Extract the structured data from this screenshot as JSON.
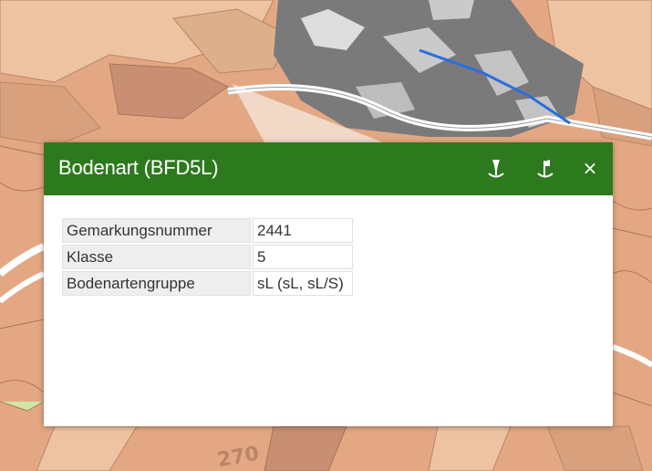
{
  "map": {
    "contour_label": "270",
    "colors": {
      "soil_base": "#e3a883",
      "soil_light": "#edc3a1",
      "soil_dark": "#c98f72",
      "settlement": "#7a7a7a",
      "water_line": "#2a6de0",
      "road": "#ffffff"
    }
  },
  "popup": {
    "title": "Bodenart (BFD5L)",
    "icons": {
      "pin_down": "pin-down-icon",
      "pin_up": "pin-up-icon",
      "close": "close-icon"
    },
    "close_symbol": "×",
    "header_color": "#2d7a1e",
    "rows": [
      {
        "key": "Gemarkungsnummer",
        "value": "2441"
      },
      {
        "key": "Klasse",
        "value": "5"
      },
      {
        "key": "Bodenartengruppe",
        "value": "sL (sL, sL/S)"
      }
    ]
  }
}
